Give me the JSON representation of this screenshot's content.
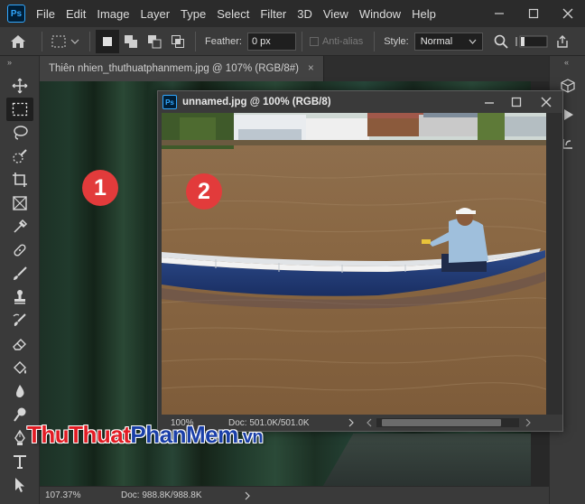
{
  "app": {
    "logo": "Ps",
    "menu": [
      "File",
      "Edit",
      "Image",
      "Layer",
      "Type",
      "Select",
      "Filter",
      "3D",
      "View",
      "Window",
      "Help"
    ],
    "window_controls": [
      "minimize",
      "maximize",
      "close"
    ]
  },
  "options_bar": {
    "feather_label": "Feather:",
    "feather_value": "0 px",
    "anti_alias_label": "Anti-alias",
    "style_label": "Style:",
    "style_value": "Normal"
  },
  "toolbox": {
    "tools": [
      "move-tool",
      "marquee-tool",
      "lasso-tool",
      "quick-selection-tool",
      "crop-tool",
      "frame-tool",
      "eyedropper-tool",
      "healing-brush-tool",
      "brush-tool",
      "clone-stamp-tool",
      "history-brush-tool",
      "eraser-tool",
      "paint-bucket-tool",
      "blur-tool",
      "dodge-tool",
      "pen-tool",
      "type-tool",
      "path-selection-tool"
    ],
    "active_tool": "marquee-tool"
  },
  "document_tab": {
    "title": "Thiên nhien_thuthuatphanmem.jpg @ 107% (RGB/8#)",
    "close": "×"
  },
  "status_bar": {
    "zoom": "107.37%",
    "doc": "Doc: 988.8K/988.8K"
  },
  "floating_window": {
    "title": "unnamed.jpg @ 100% (RGB/8)",
    "zoom": "100%",
    "doc": "Doc: 501.0K/501.0K"
  },
  "badges": [
    "1",
    "2"
  ],
  "watermark": {
    "part1": "Thu",
    "part2": "Thuat",
    "part3": "Phan",
    "part4": "Mem",
    "part5": ".vn"
  },
  "colors": {
    "menubar_bg": "#2b2b2b",
    "panel_bg": "#3a3a3a",
    "badge_red": "#e23b3b",
    "ps_blue": "#31a8ff"
  }
}
